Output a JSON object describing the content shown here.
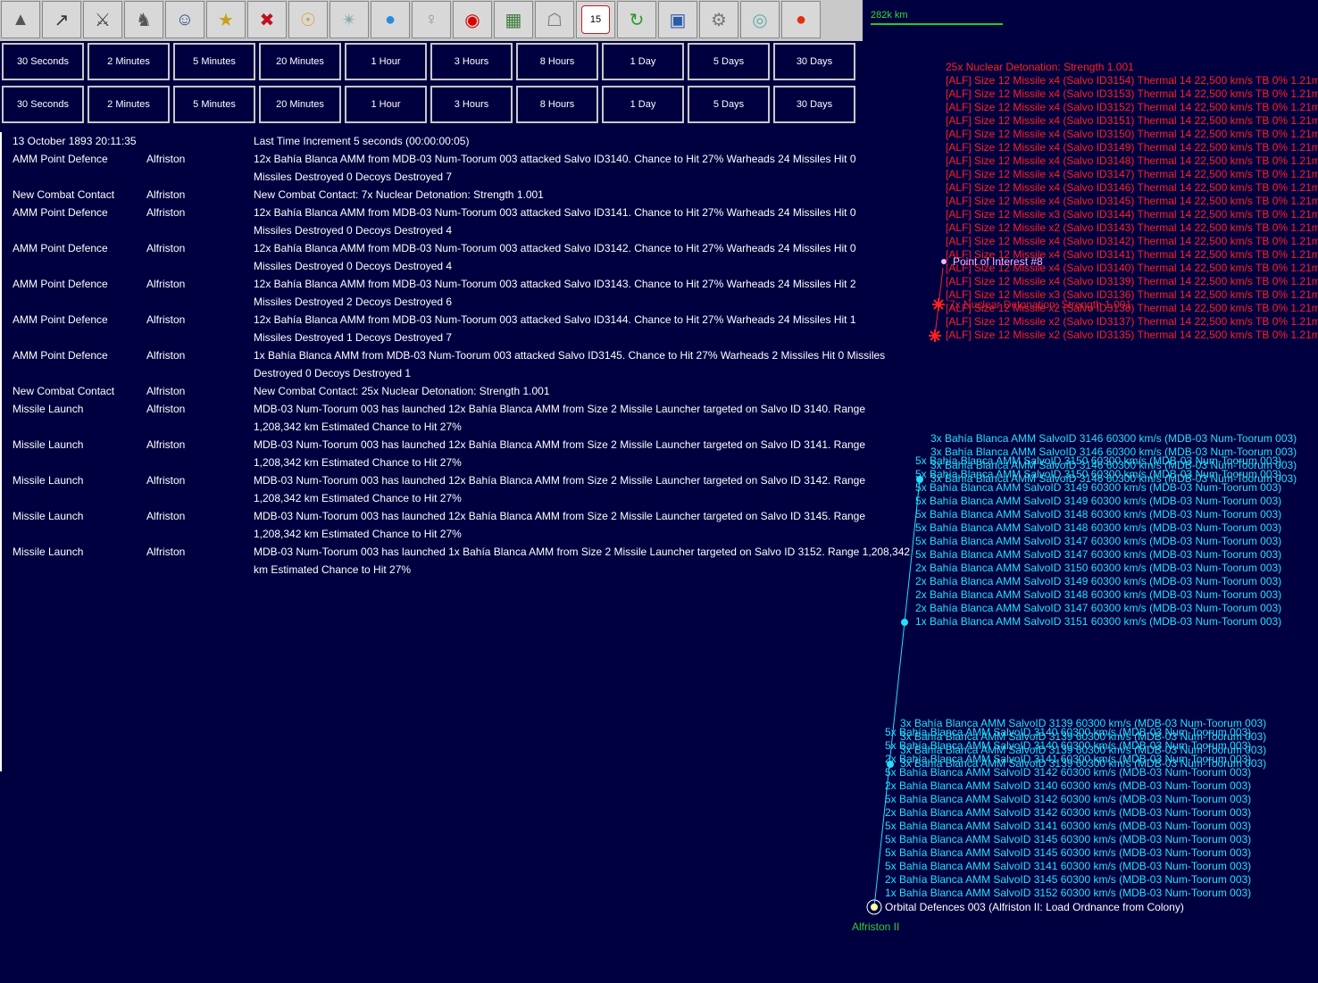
{
  "toolbar": {
    "icons": [
      "star-destroyer-icon",
      "missile-icon",
      "artillery-icon",
      "walker-icon",
      "officer-icon",
      "star-icon",
      "union-jack-icon",
      "solar-system-icon",
      "galaxy-icon",
      "planet-icon",
      "alien-icon",
      "hal-eye-icon",
      "circuit-board-icon",
      "government-building-icon",
      "calendar-icon",
      "refresh-icon",
      "save-disk-icon",
      "settings-gear-icon",
      "globe-crystal-icon",
      "red-button-icon"
    ],
    "calendar_day": "15"
  },
  "scale": {
    "label": "282k km"
  },
  "increments_row1": [
    "30 Seconds",
    "2 Minutes",
    "5 Minutes",
    "20 Minutes",
    "1 Hour",
    "3 Hours",
    "8 Hours",
    "1 Day",
    "5 Days",
    "30 Days"
  ],
  "increments_row2": [
    "30 Seconds",
    "2 Minutes",
    "5 Minutes",
    "20 Minutes",
    "1 Hour",
    "3 Hours",
    "8 Hours",
    "1 Day",
    "5 Days",
    "30 Days"
  ],
  "log": [
    {
      "type": "13 October 1893 20:11:35",
      "loc": "",
      "text": [
        "Last Time Increment 5 seconds (00:00:00:05)"
      ]
    },
    {
      "type": "AMM Point Defence",
      "loc": "Alfriston",
      "text": [
        "12x Bahía Blanca AMM from MDB-03 Num-Toorum 003 attacked Salvo ID3140.    Chance to Hit 27%    Warheads 24    Missiles Hit 0",
        "Missiles Destroyed 0    Decoys Destroyed 7"
      ]
    },
    {
      "type": "New Combat Contact",
      "loc": "Alfriston",
      "text": [
        "New Combat Contact:  7x Nuclear Detonation: Strength 1.001"
      ]
    },
    {
      "type": "AMM Point Defence",
      "loc": "Alfriston",
      "text": [
        "12x Bahía Blanca AMM from MDB-03 Num-Toorum 003 attacked Salvo ID3141.    Chance to Hit 27%    Warheads 24    Missiles Hit 0",
        "Missiles Destroyed 0    Decoys Destroyed 4"
      ]
    },
    {
      "type": "AMM Point Defence",
      "loc": "Alfriston",
      "text": [
        "12x Bahía Blanca AMM from MDB-03 Num-Toorum 003 attacked Salvo ID3142.    Chance to Hit 27%    Warheads 24    Missiles Hit 0",
        "Missiles Destroyed 0    Decoys Destroyed 4"
      ]
    },
    {
      "type": "AMM Point Defence",
      "loc": "Alfriston",
      "text": [
        "12x Bahía Blanca AMM from MDB-03 Num-Toorum 003 attacked Salvo ID3143.    Chance to Hit 27%    Warheads 24    Missiles Hit 2",
        "Missiles Destroyed 2    Decoys Destroyed 6"
      ]
    },
    {
      "type": "AMM Point Defence",
      "loc": "Alfriston",
      "text": [
        "12x Bahía Blanca AMM from MDB-03 Num-Toorum 003 attacked Salvo ID3144.    Chance to Hit 27%    Warheads 24    Missiles Hit 1",
        "Missiles Destroyed 1    Decoys Destroyed 7"
      ]
    },
    {
      "type": "AMM Point Defence",
      "loc": "Alfriston",
      "text": [
        "1x Bahía Blanca AMM from MDB-03 Num-Toorum 003 attacked Salvo ID3145.    Chance to Hit 27%    Warheads 2    Missiles Hit 0    Missiles",
        "Destroyed 0    Decoys Destroyed 1"
      ]
    },
    {
      "type": "New Combat Contact",
      "loc": "Alfriston",
      "text": [
        "New Combat Contact:  25x Nuclear Detonation: Strength 1.001"
      ]
    },
    {
      "type": "Missile Launch",
      "loc": "Alfriston",
      "text": [
        "MDB-03 Num-Toorum 003 has launched 12x Bahía Blanca AMM from Size 2 Missile Launcher targeted on Salvo ID 3140.    Range",
        "1,208,342 km    Estimated Chance to Hit 27%"
      ]
    },
    {
      "type": "Missile Launch",
      "loc": "Alfriston",
      "text": [
        "MDB-03 Num-Toorum 003 has launched 12x Bahía Blanca AMM from Size 2 Missile Launcher targeted on Salvo ID 3141.    Range",
        "1,208,342 km    Estimated Chance to Hit 27%"
      ]
    },
    {
      "type": "Missile Launch",
      "loc": "Alfriston",
      "text": [
        "MDB-03 Num-Toorum 003 has launched 12x Bahía Blanca AMM from Size 2 Missile Launcher targeted on Salvo ID 3142.    Range",
        "1,208,342 km    Estimated Chance to Hit 27%"
      ]
    },
    {
      "type": "Missile Launch",
      "loc": "Alfriston",
      "text": [
        "MDB-03 Num-Toorum 003 has launched 12x Bahía Blanca AMM from Size 2 Missile Launcher targeted on Salvo ID 3145.    Range",
        "1,208,342 km    Estimated Chance to Hit 27%"
      ]
    },
    {
      "type": "Missile Launch",
      "loc": "Alfriston",
      "text": [
        "MDB-03 Num-Toorum 003 has launched 1x Bahía Blanca AMM from Size 2 Missile Launcher targeted on Salvo ID 3152.    Range 1,208,342",
        "km    Estimated Chance to Hit 27%"
      ]
    }
  ],
  "map": {
    "enemy_header": "25x Nuclear Detonation: Strength 1.001",
    "enemy_contacts": [
      "[ALF] Size 12 Missile x4  (Salvo ID3154)  Thermal 14  22,500 km/s  TB 0%  1.21m",
      "[ALF] Size 12 Missile x4  (Salvo ID3153)  Thermal 14  22,500 km/s  TB 0%  1.21m",
      "[ALF] Size 12 Missile x4  (Salvo ID3152)  Thermal 14  22,500 km/s  TB 0%  1.21m",
      "[ALF] Size 12 Missile x4  (Salvo ID3151)  Thermal 14  22,500 km/s  TB 0%  1.21m",
      "[ALF] Size 12 Missile x4  (Salvo ID3150)  Thermal 14  22,500 km/s  TB 0%  1.21m",
      "[ALF] Size 12 Missile x4  (Salvo ID3149)  Thermal 14  22,500 km/s  TB 0%  1.21m",
      "[ALF] Size 12 Missile x4  (Salvo ID3148)  Thermal 14  22,500 km/s  TB 0%  1.21m",
      "[ALF] Size 12 Missile x4  (Salvo ID3147)  Thermal 14  22,500 km/s  TB 0%  1.21m",
      "[ALF] Size 12 Missile x4  (Salvo ID3146)  Thermal 14  22,500 km/s  TB 0%  1.21m",
      "[ALF] Size 12 Missile x4  (Salvo ID3145)  Thermal 14  22,500 km/s  TB 0%  1.21m",
      "[ALF] Size 12 Missile x3  (Salvo ID3144)  Thermal 14  22,500 km/s  TB 0%  1.21m",
      "[ALF] Size 12 Missile x2  (Salvo ID3143)  Thermal 14  22,500 km/s  TB 0%  1.21m",
      "[ALF] Size 12 Missile x4  (Salvo ID3142)  Thermal 14  22,500 km/s  TB 0%  1.21m",
      "[ALF] Size 12 Missile x4  (Salvo ID3141)  Thermal 14  22,500 km/s  TB 0%  1.21m",
      "[ALF] Size 12 Missile x4  (Salvo ID3140)  Thermal 14  22,500 km/s  TB 0%  1.21m",
      "[ALF] Size 12 Missile x4  (Salvo ID3139)  Thermal 14  22,500 km/s  TB 0%  1.21m",
      "[ALF] Size 12 Missile x3  (Salvo ID3136)  Thermal 14  22,500 km/s  TB 0%  1.21m",
      "[ALF] Size 12 Missile x2  (Salvo ID3138)  Thermal 14  22,500 km/s  TB 0%  1.21m",
      "[ALF] Size 12 Missile x2  (Salvo ID3137)  Thermal 14  22,500 km/s  TB 0%  1.21m",
      "[ALF] Size 12 Missile x2  (Salvo ID3135)  Thermal 14  22,500 km/s  TB 0%  1.21m"
    ],
    "poi_label": "Point of Interest #8",
    "nuke_label": "7x Nuclear Detonation: Strength 1.001",
    "upper_salvo_top": [
      "3x Bahía Blanca AMM  SalvoID 3146  60300 km/s (MDB-03 Num-Toorum 003)",
      "3x Bahía Blanca AMM  SalvoID 3146  60300 km/s (MDB-03 Num-Toorum 003)",
      "3x Bahía Blanca AMM  SalvoID 3146  60300 km/s (MDB-03 Num-Toorum 003)",
      "3x Bahía Blanca AMM  SalvoID 3146  60300 km/s (MDB-03 Num-Toorum 003)"
    ],
    "upper_salvo_over": [
      "5x Bahía Blanca AMM  SalvoID 3150  60300 km/s (MDB-03 Num-Toorum 003)",
      "5x Bahía Blanca AMM  SalvoID 3150  60300 km/s (MDB-03 Num-Toorum 003)"
    ],
    "upper_salvos": [
      "5x Bahía Blanca AMM  SalvoID 3149  60300 km/s (MDB-03 Num-Toorum 003)",
      "5x Bahía Blanca AMM  SalvoID 3149  60300 km/s (MDB-03 Num-Toorum 003)",
      "5x Bahía Blanca AMM  SalvoID 3148  60300 km/s (MDB-03 Num-Toorum 003)",
      "5x Bahía Blanca AMM  SalvoID 3148  60300 km/s (MDB-03 Num-Toorum 003)",
      "5x Bahía Blanca AMM  SalvoID 3147  60300 km/s (MDB-03 Num-Toorum 003)",
      "5x Bahía Blanca AMM  SalvoID 3147  60300 km/s (MDB-03 Num-Toorum 003)",
      "2x Bahía Blanca AMM  SalvoID 3150  60300 km/s (MDB-03 Num-Toorum 003)",
      "2x Bahía Blanca AMM  SalvoID 3149  60300 km/s (MDB-03 Num-Toorum 003)",
      "2x Bahía Blanca AMM  SalvoID 3148  60300 km/s (MDB-03 Num-Toorum 003)",
      "2x Bahía Blanca AMM  SalvoID 3147  60300 km/s (MDB-03 Num-Toorum 003)",
      "1x Bahía Blanca AMM  SalvoID 3151  60300 km/s (MDB-03 Num-Toorum 003)"
    ],
    "lower_salvo_top": [
      "3x Bahía Blanca AMM  SalvoID 3139  60300 km/s (MDB-03 Num-Toorum 003)",
      "3x Bahía Blanca AMM  SalvoID 3139  60300 km/s (MDB-03 Num-Toorum 003)",
      "3x Bahía Blanca AMM  SalvoID 3139  60300 km/s (MDB-03 Num-Toorum 003)",
      "3x Bahía Blanca AMM  SalvoID 3139  60300 km/s (MDB-03 Num-Toorum 003)"
    ],
    "lower_salvo_over": [
      "5x Bahía Blanca AMM  SalvoID 3140  60300 km/s (MDB-03 Num-Toorum 003)",
      "5x Bahía Blanca AMM  SalvoID 3140  60300 km/s (MDB-03 Num-Toorum 003)",
      "2x Bahía Blanca AMM  SalvoID 3141  60300 km/s (MDB-03 Num-Toorum 003)"
    ],
    "lower_salvos": [
      "5x Bahía Blanca AMM  SalvoID 3142  60300 km/s (MDB-03 Num-Toorum 003)",
      "2x Bahía Blanca AMM  SalvoID 3140  60300 km/s (MDB-03 Num-Toorum 003)",
      "5x Bahía Blanca AMM  SalvoID 3142  60300 km/s (MDB-03 Num-Toorum 003)",
      "2x Bahía Blanca AMM  SalvoID 3142  60300 km/s (MDB-03 Num-Toorum 003)",
      "5x Bahía Blanca AMM  SalvoID 3141  60300 km/s (MDB-03 Num-Toorum 003)",
      "5x Bahía Blanca AMM  SalvoID 3145  60300 km/s (MDB-03 Num-Toorum 003)",
      "5x Bahía Blanca AMM  SalvoID 3145  60300 km/s (MDB-03 Num-Toorum 003)",
      "5x Bahía Blanca AMM  SalvoID 3141  60300 km/s (MDB-03 Num-Toorum 003)",
      "2x Bahía Blanca AMM  SalvoID 3145  60300 km/s (MDB-03 Num-Toorum 003)",
      "1x Bahía Blanca AMM  SalvoID 3152  60300 km/s (MDB-03 Num-Toorum 003)"
    ],
    "orbital_label": "Orbital Defences 003  (Alfriston II: Load Ordnance from Colony)",
    "planet_label": "Alfriston II",
    "colors": {
      "enemy": "#ff2020",
      "friendly": "#22e0ff",
      "planet": "#33cc33",
      "poi": "#ffb0ff"
    }
  }
}
